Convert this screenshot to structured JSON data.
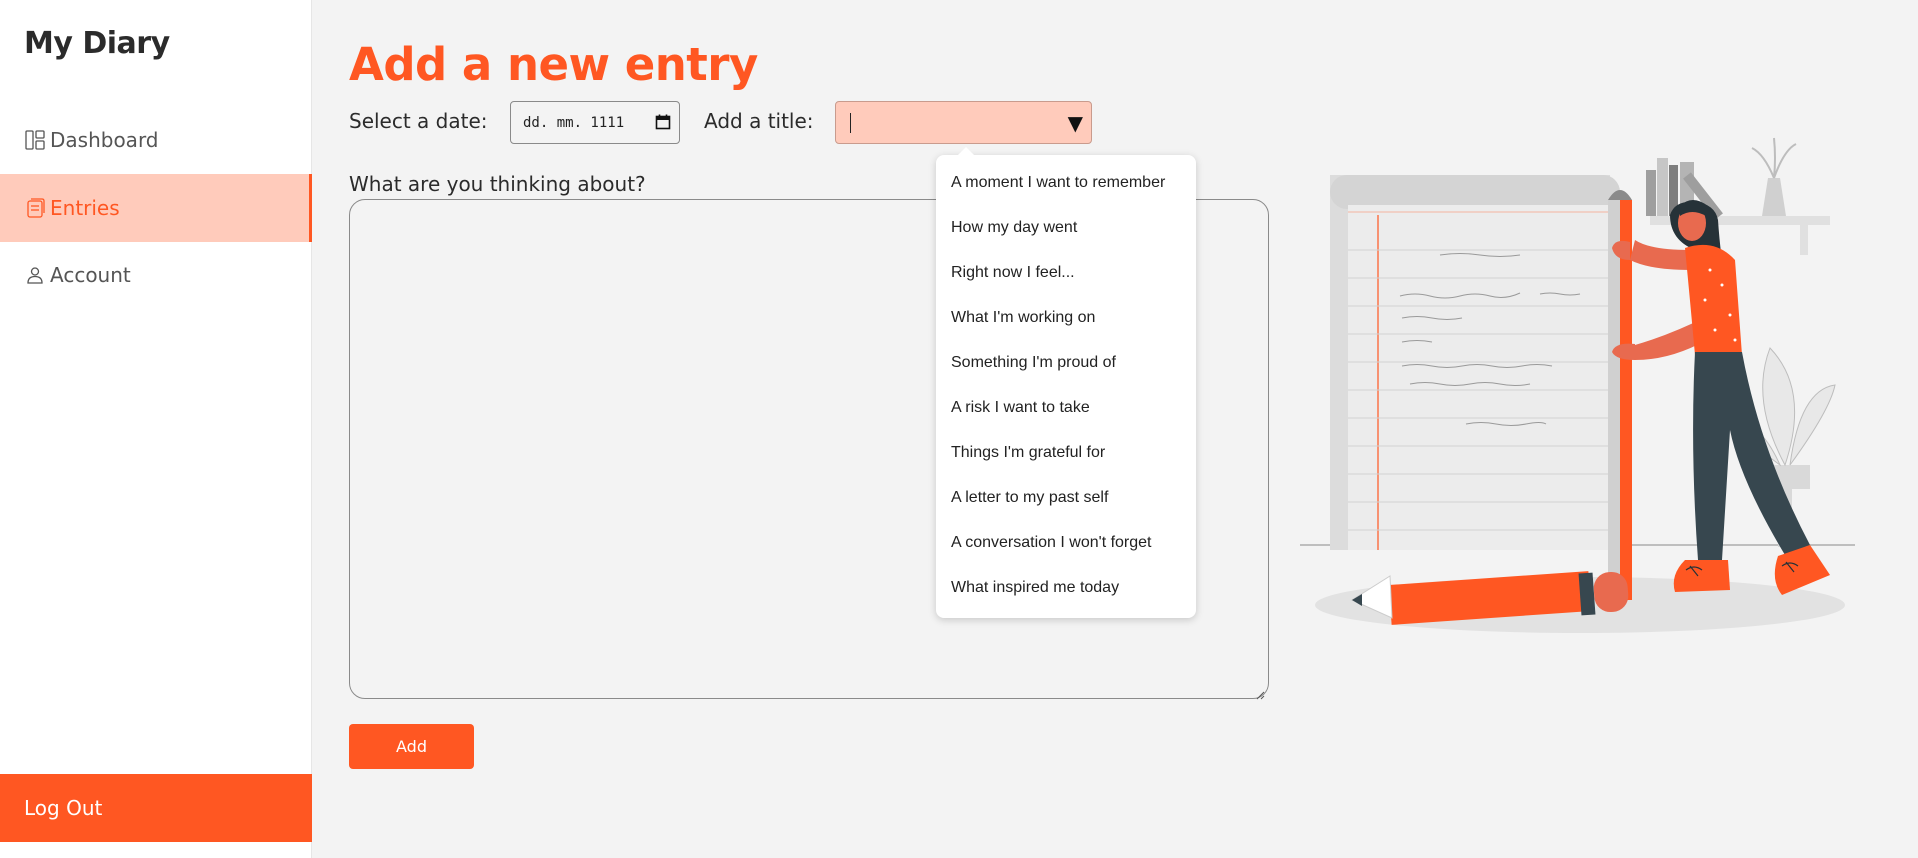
{
  "sidebar": {
    "brand": "My Diary",
    "items": [
      {
        "label": "Dashboard"
      },
      {
        "label": "Entries"
      },
      {
        "label": "Account"
      }
    ],
    "logout": "Log Out"
  },
  "main": {
    "title": "Add a new entry",
    "date_label": "Select a date:",
    "date_value": "dd. mm. 1111",
    "title_label": "Add a title:",
    "prompt_label": "What are you thinking about?",
    "add_button": "Add"
  },
  "dropdown": {
    "options": [
      "A moment I want to remember",
      "How my day went",
      "Right now I feel...",
      "What I'm working on",
      "Something I'm proud of",
      "A risk I want to take",
      "Things I'm grateful for",
      "A letter to my past self",
      "A conversation I won't forget",
      "What inspired me today"
    ]
  },
  "colors": {
    "accent": "#ff5722",
    "accent_light": "#ffcbbb",
    "background": "#f3f3f3"
  }
}
